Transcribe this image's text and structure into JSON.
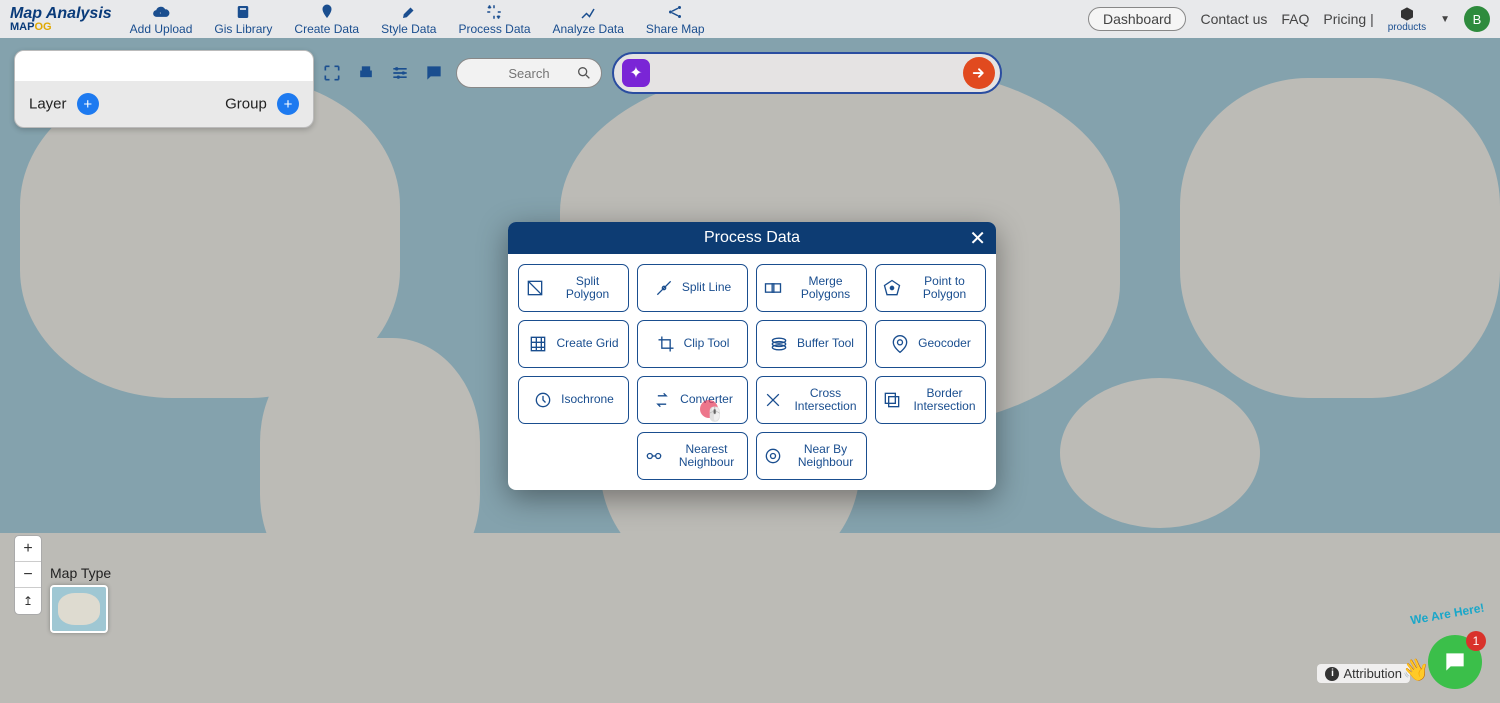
{
  "brand": {
    "title": "Map Analysis",
    "sub_a": "MAP",
    "sub_b": "OG"
  },
  "nav": [
    {
      "label": "Add Upload"
    },
    {
      "label": "Gis Library"
    },
    {
      "label": "Create Data"
    },
    {
      "label": "Style Data"
    },
    {
      "label": "Process Data"
    },
    {
      "label": "Analyze Data"
    },
    {
      "label": "Share Map"
    }
  ],
  "rightnav": {
    "dashboard": "Dashboard",
    "contact": "Contact us",
    "faq": "FAQ",
    "pricing": "Pricing |",
    "products": "products",
    "avatar": "B"
  },
  "layerpanel": {
    "layer": "Layer",
    "group": "Group"
  },
  "search": {
    "placeholder": "Search"
  },
  "bigsearch": {
    "placeholder": ""
  },
  "maptype": {
    "label": "Map Type"
  },
  "attribution": {
    "label": "Attribution"
  },
  "chat": {
    "tag": "We Are Here!",
    "count": "1"
  },
  "modal": {
    "title": "Process Data",
    "tools": [
      "Split Polygon",
      "Split Line",
      "Merge Polygons",
      "Point to Polygon",
      "Create Grid",
      "Clip Tool",
      "Buffer Tool",
      "Geocoder",
      "Isochrone",
      "Converter",
      "Cross Intersection",
      "Border Intersection",
      "Nearest Neighbour",
      "Near By Neighbour"
    ]
  }
}
